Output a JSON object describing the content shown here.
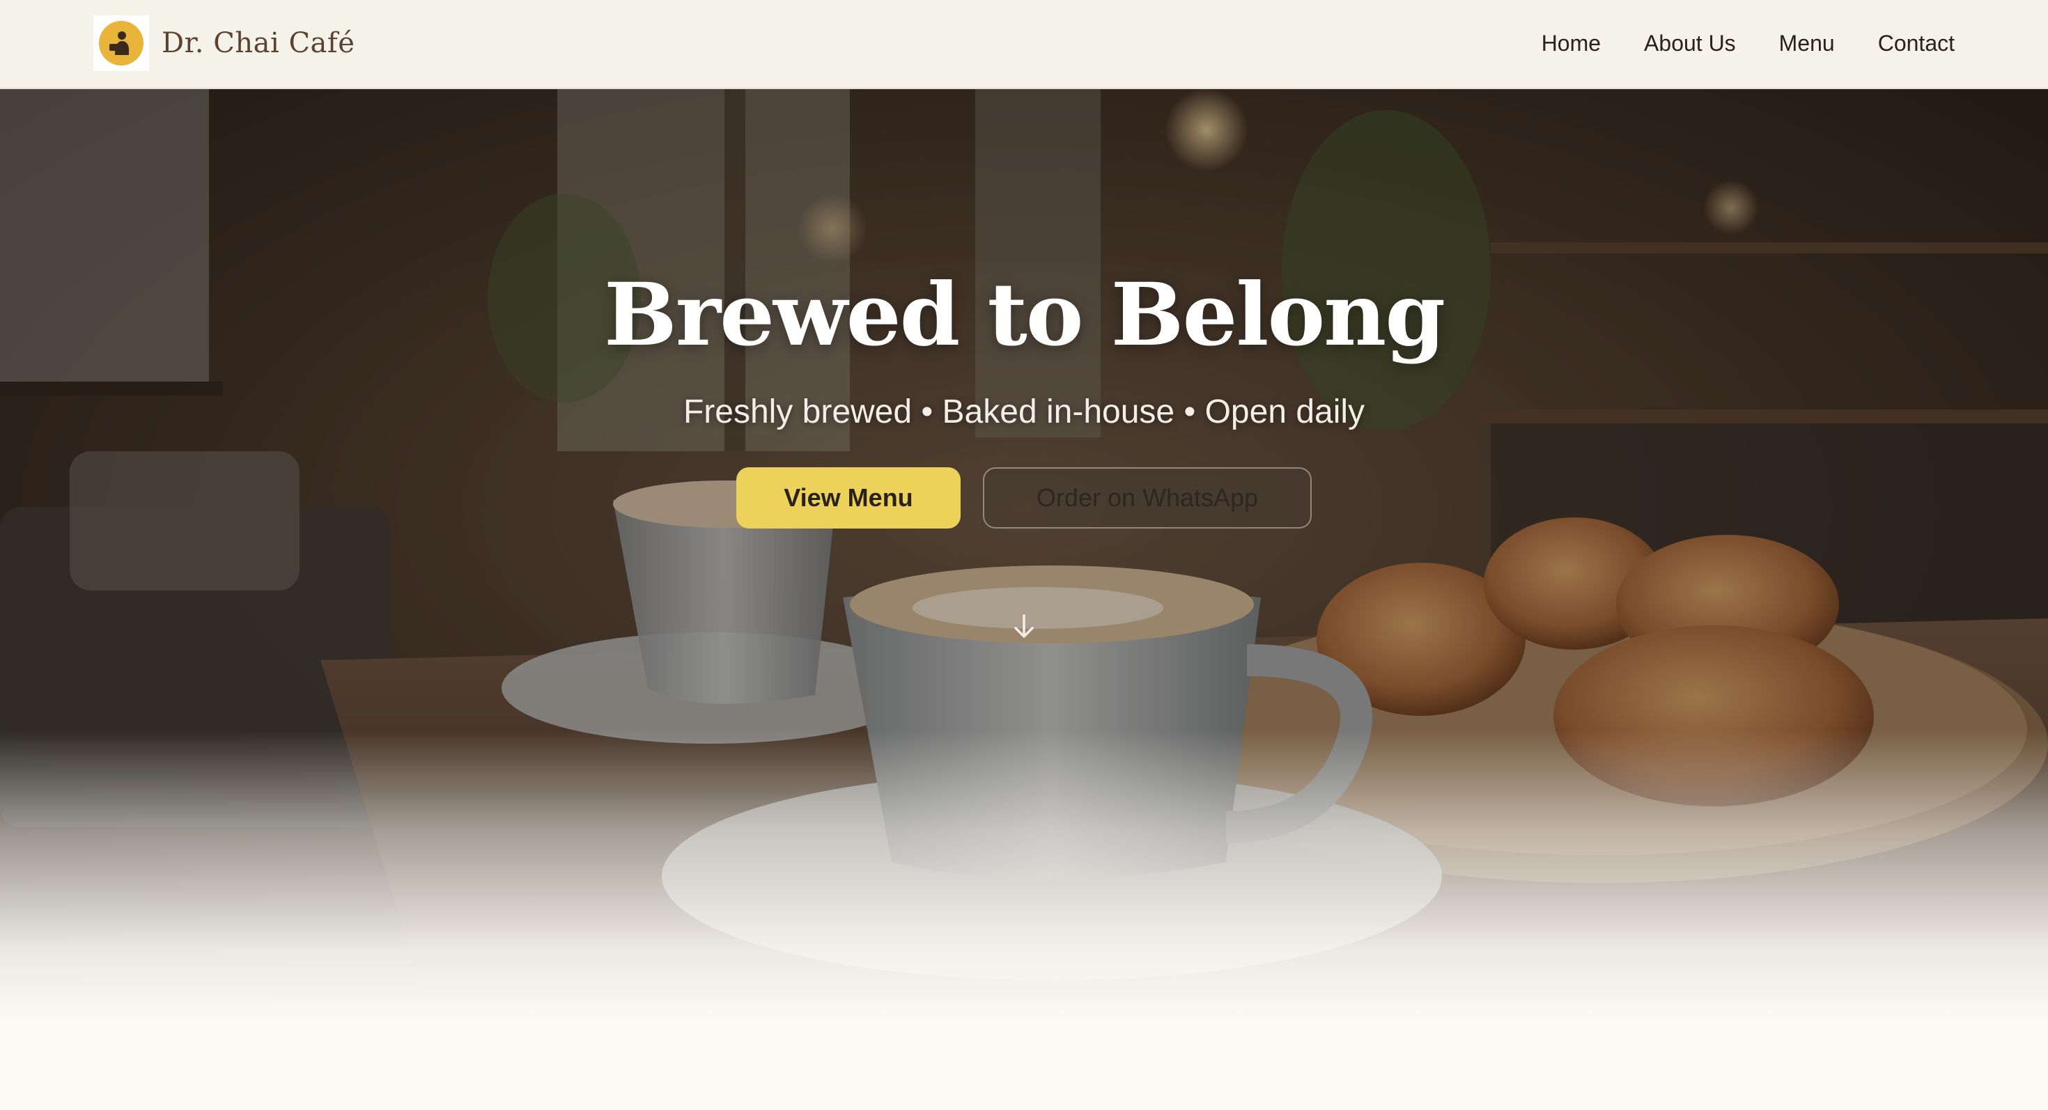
{
  "header": {
    "brand_name": "Dr. Chai Café",
    "logo_icon": "chai-cafe-logo-icon",
    "nav": [
      {
        "label": "Home"
      },
      {
        "label": "About Us"
      },
      {
        "label": "Menu"
      },
      {
        "label": "Contact"
      }
    ]
  },
  "hero": {
    "title": "Brewed to Belong",
    "subtitle": "Freshly brewed • Baked in-house • Open daily",
    "primary_button": "View Menu",
    "secondary_button": "Order on WhatsApp",
    "scroll_icon": "arrow-down-icon",
    "background": "cafe-table-coffee-pastries-photo"
  },
  "colors": {
    "accent": "#ecd25a",
    "header_bg": "#f5f2e9",
    "brand_text": "#5a4330",
    "page_bg": "#fcfaf4"
  }
}
